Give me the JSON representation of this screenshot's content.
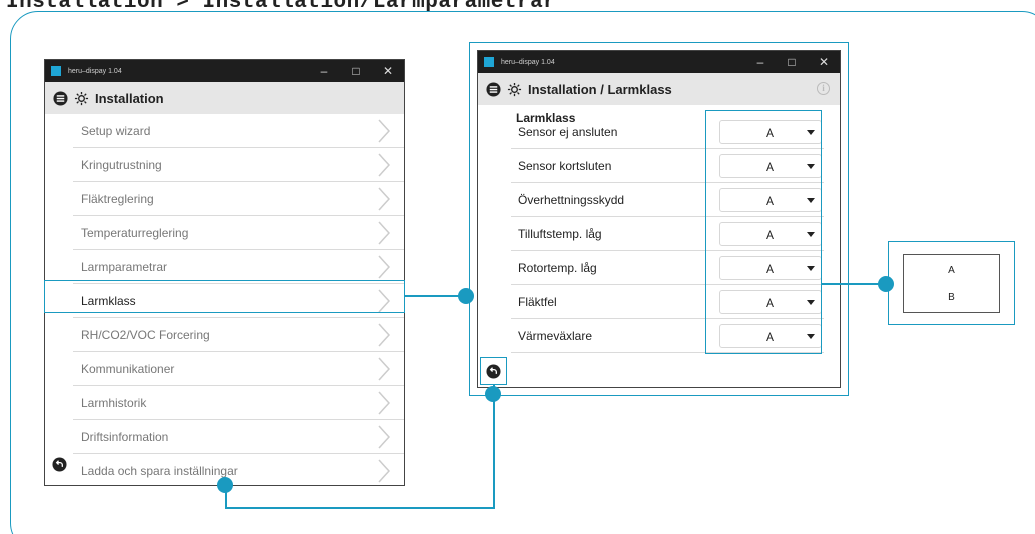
{
  "page_title": "Installation > Installation/Larmparametrar",
  "left_window": {
    "titlebar": "heru–dispay 1.04",
    "header_title": "Installation",
    "menu": [
      {
        "label": "Setup wizard"
      },
      {
        "label": "Kringutrustning"
      },
      {
        "label": "Fläktreglering"
      },
      {
        "label": "Temperaturreglering"
      },
      {
        "label": "Larmparametrar"
      },
      {
        "label": "Larmklass"
      },
      {
        "label": "RH/CO2/VOC Forcering"
      },
      {
        "label": "Kommunikationer"
      },
      {
        "label": "Larmhistorik"
      },
      {
        "label": "Driftsinformation"
      },
      {
        "label": "Ladda och spara inställningar"
      }
    ]
  },
  "right_window": {
    "titlebar": "heru–dispay 1.04",
    "header_title": "Installation / Larmklass",
    "section_title": "Larmklass",
    "rows": [
      {
        "label": "Sensor ej ansluten",
        "value": "A"
      },
      {
        "label": "Sensor kortsluten",
        "value": "A"
      },
      {
        "label": "Överhettningsskydd",
        "value": "A"
      },
      {
        "label": "Tilluftstemp. låg",
        "value": "A"
      },
      {
        "label": "Rotortemp. låg",
        "value": "A"
      },
      {
        "label": "Fläktfel",
        "value": "A"
      },
      {
        "label": "Värmeväxlare",
        "value": "A"
      }
    ]
  },
  "dropdown_options": [
    "A",
    "B"
  ],
  "colors": {
    "accent": "#1a9ac0",
    "titlebar": "#1e1e1e",
    "header": "#e6e6e6"
  }
}
